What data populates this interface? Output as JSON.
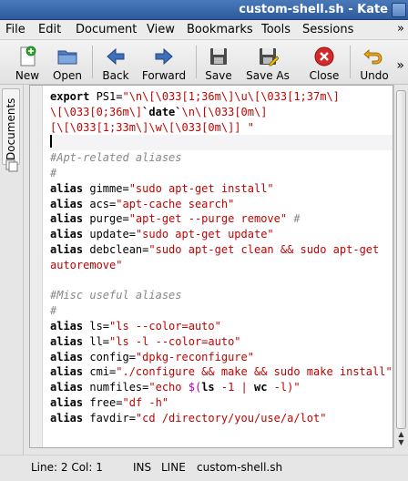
{
  "window": {
    "title": "custom-shell.sh - Kate"
  },
  "menubar": {
    "items": [
      "File",
      "Edit",
      "Document",
      "View",
      "Bookmarks",
      "Tools",
      "Sessions"
    ],
    "more": "»"
  },
  "toolbar": {
    "buttons": [
      {
        "label": "New",
        "icon": "new-document-icon"
      },
      {
        "label": "Open",
        "icon": "folder-open-icon"
      },
      {
        "label": "Back",
        "icon": "arrow-left-icon"
      },
      {
        "label": "Forward",
        "icon": "arrow-right-icon"
      },
      {
        "label": "Save",
        "icon": "floppy-disk-icon"
      },
      {
        "label": "Save As",
        "icon": "floppy-save-as-icon"
      },
      {
        "label": "Close",
        "icon": "close-red-circle-icon"
      },
      {
        "label": "Undo",
        "icon": "undo-arrow-icon"
      }
    ],
    "more": "»"
  },
  "sidebar": {
    "tab_label": "Documents"
  },
  "editor": {
    "lines": [
      [
        {
          "t": "export",
          "c": "kw"
        },
        {
          "t": " PS1=",
          "c": "op"
        },
        {
          "t": "\"\\n\\[\\033[1;36m\\]\\u\\[\\033[1;37m\\]",
          "c": "str"
        }
      ],
      [
        {
          "t": "\\[\\033[0;36m\\]",
          "c": "str"
        },
        {
          "t": "`date`",
          "c": "kw"
        },
        {
          "t": "\\n\\[\\033[0m\\]",
          "c": "str"
        }
      ],
      [
        {
          "t": "[\\[\\033[1;33m\\]\\w\\[\\033[0m\\]] \"",
          "c": "str"
        }
      ],
      [],
      [
        {
          "t": "#Apt-related aliases",
          "c": "cmt"
        }
      ],
      [
        {
          "t": "#",
          "c": "cmt"
        }
      ],
      [
        {
          "t": "alias",
          "c": "kw"
        },
        {
          "t": " gimme=",
          "c": "op"
        },
        {
          "t": "\"sudo apt-get install\"",
          "c": "str"
        }
      ],
      [
        {
          "t": "alias",
          "c": "kw"
        },
        {
          "t": " acs=",
          "c": "op"
        },
        {
          "t": "\"apt-cache search\"",
          "c": "str"
        }
      ],
      [
        {
          "t": "alias",
          "c": "kw"
        },
        {
          "t": " purge=",
          "c": "op"
        },
        {
          "t": "\"apt-get --purge remove\"",
          "c": "str"
        },
        {
          "t": " #",
          "c": "cmt"
        }
      ],
      [
        {
          "t": "alias",
          "c": "kw"
        },
        {
          "t": " update=",
          "c": "op"
        },
        {
          "t": "\"sudo apt-get update\"",
          "c": "str"
        }
      ],
      [
        {
          "t": "alias",
          "c": "kw"
        },
        {
          "t": " debclean=",
          "c": "op"
        },
        {
          "t": "\"sudo apt-get clean && sudo apt-get",
          "c": "str"
        }
      ],
      [
        {
          "t": "autoremove\"",
          "c": "str"
        }
      ],
      [],
      [
        {
          "t": "#Misc useful aliases",
          "c": "cmt"
        }
      ],
      [
        {
          "t": "#",
          "c": "cmt"
        }
      ],
      [
        {
          "t": "alias",
          "c": "kw"
        },
        {
          "t": " ls=",
          "c": "op"
        },
        {
          "t": "\"ls --color=auto\"",
          "c": "str"
        }
      ],
      [
        {
          "t": "alias",
          "c": "kw"
        },
        {
          "t": " ll=",
          "c": "op"
        },
        {
          "t": "\"ls -l --color=auto\"",
          "c": "str"
        }
      ],
      [
        {
          "t": "alias",
          "c": "kw"
        },
        {
          "t": " config=",
          "c": "op"
        },
        {
          "t": "\"dpkg-reconfigure\"",
          "c": "str"
        }
      ],
      [
        {
          "t": "alias",
          "c": "kw"
        },
        {
          "t": " cmi=",
          "c": "op"
        },
        {
          "t": "\"./configure && make && sudo make install\"",
          "c": "str"
        }
      ],
      [
        {
          "t": "alias",
          "c": "kw"
        },
        {
          "t": " numfiles=",
          "c": "op"
        },
        {
          "t": "\"echo ",
          "c": "str"
        },
        {
          "t": "$(",
          "c": "var"
        },
        {
          "t": "ls",
          "c": "kw"
        },
        {
          "t": " -1 | ",
          "c": "str"
        },
        {
          "t": "wc",
          "c": "kw"
        },
        {
          "t": " -l)\"",
          "c": "str"
        }
      ],
      [
        {
          "t": "alias",
          "c": "kw"
        },
        {
          "t": " free=",
          "c": "op"
        },
        {
          "t": "\"df -h\"",
          "c": "str"
        }
      ],
      [
        {
          "t": "alias",
          "c": "kw"
        },
        {
          "t": " favdir=",
          "c": "op"
        },
        {
          "t": "\"cd /directory/you/use/a/lot\"",
          "c": "str"
        }
      ]
    ],
    "cursor_line_index": 3
  },
  "statusbar": {
    "position": "Line: 2 Col: 1",
    "mode": "INS",
    "selection_mode": "LINE",
    "filename": "custom-shell.sh"
  },
  "colors": {
    "keyword": "#000000",
    "string": "#bf0303",
    "comment": "#888888",
    "variable": "#b000b0",
    "titlebar": "#2d5b9d"
  }
}
